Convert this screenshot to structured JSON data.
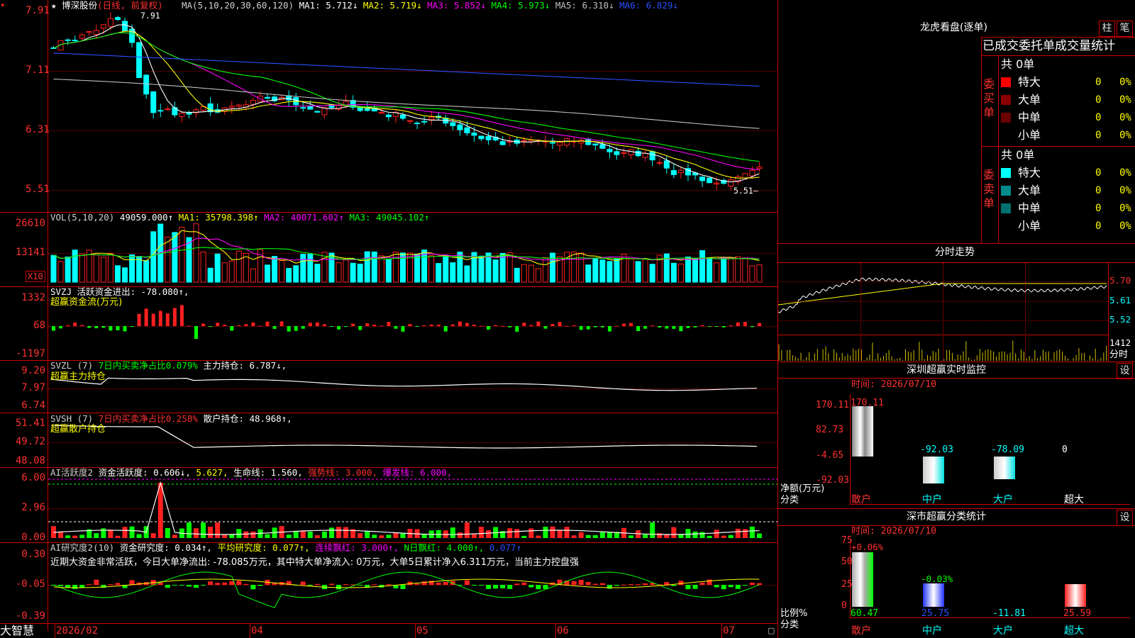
{
  "brand": "大智慧",
  "stock": {
    "star": "★",
    "name": "博深股份",
    "mode": "(日线, 前复权)"
  },
  "ma_line": [
    {
      "label": "MA(5,10,20,30,60,120)",
      "color": "#d0d0d0"
    },
    {
      "label": "MA1: 5.712↓",
      "color": "#ffffff"
    },
    {
      "label": "MA2: 5.719↓",
      "color": "#ffff00"
    },
    {
      "label": "MA3: 5.852↓",
      "color": "#ff00ff"
    },
    {
      "label": "MA4: 5.973↓",
      "color": "#00ff00"
    },
    {
      "label": "MA5: 6.310↓",
      "color": "#c0c0c0"
    },
    {
      "label": "MA6: 6.829↓",
      "color": "#2a50ff"
    }
  ],
  "price_axis": [
    "7.91",
    "7.11",
    "6.31",
    "5.51"
  ],
  "price_high": "7.91",
  "price_low": "5.51",
  "vol": {
    "labels": [
      {
        "label": "VOL(5,10,20)",
        "color": "#d0d0d0"
      },
      {
        "label": "49059.000↑",
        "color": "#ffffff"
      },
      {
        "label": "MA1: 35798.398↑",
        "color": "#ffff00"
      },
      {
        "label": "MA2: 40071.602↑",
        "color": "#ff00ff"
      },
      {
        "label": "MA3: 49045.102↑",
        "color": "#00ff00"
      }
    ],
    "axis": [
      "26610",
      "13141"
    ],
    "unit": "X10"
  },
  "svzj": {
    "labels": [
      {
        "label": "SVZJ  活跃资金进出: -78.080↑,",
        "color": "#ffffff"
      }
    ],
    "sub": "超赢资金流(万元)",
    "axis": [
      "1332",
      "68",
      "-1197"
    ]
  },
  "svzl": {
    "labels": [
      {
        "label": "SVZL (7)",
        "color": "#d0d0d0"
      },
      {
        "label": "7日内买卖净占比0.079%",
        "color": "#00ff00"
      },
      {
        "label": "主力持仓: 6.787↓,",
        "color": "#ffffff"
      }
    ],
    "sub": "超赢主力持仓",
    "axis": [
      "9.20",
      "7.97",
      "6.74"
    ]
  },
  "svsh": {
    "labels": [
      {
        "label": "SVSH (7)",
        "color": "#d0d0d0"
      },
      {
        "label": "7日内买卖净占比0.258%",
        "color": "#ff3030"
      },
      {
        "label": "散户持仓: 48.968↑,",
        "color": "#ffffff"
      }
    ],
    "sub": "超赢散户持仓",
    "axis": [
      "51.41",
      "49.72",
      "48.08"
    ]
  },
  "ai1": {
    "labels": [
      {
        "label": "AI活跃度2",
        "color": "#d0d0d0"
      },
      {
        "label": "资金活跃度: 0.606↓,",
        "color": "#ffffff"
      },
      {
        "label": "5.627,",
        "color": "#ffff00"
      },
      {
        "label": "生命线: 1.560,",
        "color": "#ffffff"
      },
      {
        "label": "强势线: 3.000,",
        "color": "#ff3030"
      },
      {
        "label": "爆发线: 6.000,",
        "color": "#ff00ff"
      }
    ],
    "axis": [
      "6.00",
      "2.96",
      "0.00"
    ]
  },
  "ai2": {
    "labels": [
      {
        "label": "AI研究度2(10)",
        "color": "#d0d0d0"
      },
      {
        "label": "资金研究度: 0.034↑,",
        "color": "#ffffff"
      },
      {
        "label": "平均研究度: 0.077↑,",
        "color": "#ffff00"
      },
      {
        "label": "连续飘红: 3.000↑,",
        "color": "#ff00ff"
      },
      {
        "label": "N日飘红: 4.000↑,",
        "color": "#00ff00"
      },
      {
        "label": "0.077↑",
        "color": "#2a50ff"
      }
    ],
    "desc": "近期大资金非常活跃，今日大单净流出: -78.085万元，其中特大单净流入: 0万元，大单5日累计净入6.311万元，当前主力控盘强",
    "axis": [
      "0.30",
      "-0.05",
      "-0.39"
    ]
  },
  "date_axis": [
    "2026/02",
    "04",
    "05",
    "06",
    "07"
  ],
  "right": {
    "lhb_title": "龙虎看盘(逐单)",
    "btn_zhu": "柱",
    "btn_bi": "笔",
    "stat_title": "已成交委托单成交量统计",
    "buy": {
      "side": "委买单",
      "total": "共 0单",
      "rows": [
        {
          "label": "特大",
          "vol": "0",
          "pct": "0%",
          "color": "#ff0000"
        },
        {
          "label": "大单",
          "vol": "0",
          "pct": "0%",
          "color": "#8b0000"
        },
        {
          "label": "中单",
          "vol": "0",
          "pct": "0%",
          "color": "#6a0000"
        },
        {
          "label": "小单",
          "vol": "0",
          "pct": "0%",
          "color": ""
        }
      ]
    },
    "sell": {
      "side": "委卖单",
      "total": "共 0单",
      "rows": [
        {
          "label": "特大",
          "vol": "0",
          "pct": "0%",
          "color": "#00ffff"
        },
        {
          "label": "大单",
          "vol": "0",
          "pct": "0%",
          "color": "#008b8b"
        },
        {
          "label": "中单",
          "vol": "0",
          "pct": "0%",
          "color": "#007070"
        },
        {
          "label": "小单",
          "vol": "0",
          "pct": "0%",
          "color": ""
        }
      ]
    },
    "intraday": {
      "title": "分时走势",
      "axis": [
        "5.70",
        "5.61",
        "5.52"
      ],
      "vol_max": "1412",
      "vol_label": "分时"
    },
    "monitor": {
      "title": "深圳超赢实时监控",
      "btn": "设",
      "time": "时间: 2026/07/10",
      "axis": [
        "170.11",
        "82.73",
        "-4.65",
        "-92.03"
      ],
      "ylabel": "净额(万元)",
      "xlabel": "分类",
      "bars": [
        {
          "cat": "散户",
          "value": "170.11"
        },
        {
          "cat": "中户",
          "value": "-92.03"
        },
        {
          "cat": "大户",
          "value": "-78.09"
        },
        {
          "cat": "超大",
          "value": "0"
        }
      ]
    },
    "classify": {
      "title": "深市超赢分类统计",
      "btn": "设",
      "time": "时间: 2026/07/10",
      "axis": [
        "75",
        "50",
        "25",
        "0"
      ],
      "ylabel": "比例%",
      "xlabel": "分类",
      "top": [
        "+0.06%",
        "-0.03%"
      ],
      "bars": [
        {
          "cat": "散户",
          "value": "60.47"
        },
        {
          "cat": "中户",
          "value": "25.75"
        },
        {
          "cat": "大户",
          "value": "-11.81"
        },
        {
          "cat": "超大",
          "value": "25.59"
        }
      ]
    }
  },
  "colors": {
    "up": "#ff2020",
    "down": "#00ffff",
    "grid": "#cc0000"
  }
}
